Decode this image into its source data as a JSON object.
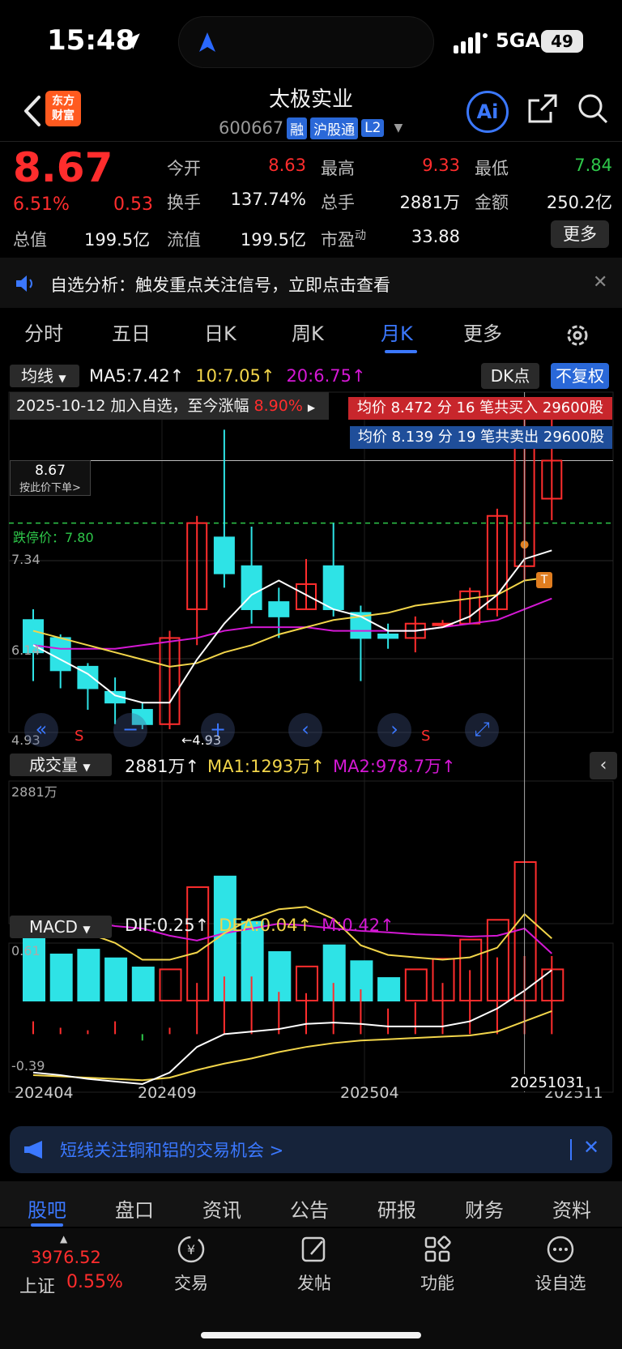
{
  "status_bar": {
    "time": "15:48",
    "network": "5GA",
    "battery": "49"
  },
  "header": {
    "brand_logo": "东方\n财富",
    "stock_name": "太极实业",
    "stock_code": "600667",
    "tags": [
      "融",
      "沪股通",
      "L2"
    ],
    "ai_label": "Ai"
  },
  "quote": {
    "price": "8.67",
    "pct_change": "6.51%",
    "change": "0.53",
    "open_label": "今开",
    "open": "8.63",
    "high_label": "最高",
    "high": "9.33",
    "low_label": "最低",
    "low": "7.84",
    "turnover_label": "换手",
    "turnover": "137.74%",
    "volume_label": "总手",
    "volume": "2881万",
    "amount_label": "金额",
    "amount": "250.2亿",
    "mcap_label": "总值",
    "mcap": "199.5亿",
    "float_label": "流值",
    "float_mcap": "199.5亿",
    "pe_label": "市盈",
    "pe_sup": "动",
    "pe": "33.88",
    "more_label": "更多"
  },
  "notice": {
    "text": "自选分析：触发重点关注信号，立即点击查看"
  },
  "chart_tabs": [
    "分时",
    "五日",
    "日K",
    "周K",
    "月K",
    "更多"
  ],
  "active_tab": "月K",
  "indicators": {
    "ma_select": "均线",
    "ma5": "MA5:7.42↑",
    "ma10": "10:7.05↑",
    "ma20": "20:6.75↑",
    "dk_label": "DK点",
    "adjust_label": "不复权"
  },
  "overlays": {
    "alert": "2025-10-12 加入自选，至今涨幅",
    "alert_pct": "8.90%",
    "buy": "均价 8.472 分 16 笔共买入 29600股",
    "sell": "均价 8.139 分 19 笔共卖出 29600股",
    "cur_price": "8.67",
    "cur_price_hint": "按此价下单>",
    "limit_down": "跌停价：7.80",
    "y_label_734": "7.34",
    "y_label_614": "6.14",
    "y_label_493": "4.93",
    "min_marker": "←4.93",
    "sell_marker": "S",
    "t_marker": "T",
    "cursor_date": "20251031"
  },
  "volume_panel": {
    "select": "成交量",
    "vol": "2881万↑",
    "ma1": "MA1:1293万↑",
    "ma2": "MA2:978.7万↑",
    "y_max": "2881万"
  },
  "macd_panel": {
    "select": "MACD",
    "dif": "DIF:0.25↑",
    "dea": "DEA:0.04↑",
    "m": "M:0.42↑",
    "y_max": "0.61",
    "y_min": "-0.39"
  },
  "x_axis": [
    "202404",
    "202409",
    "202504",
    "202511"
  ],
  "chart_data": {
    "type": "candlestick",
    "ylim": [
      4.93,
      9.33
    ],
    "candles": [
      {
        "o": 6.45,
        "c": 6.0,
        "h": 6.6,
        "l": 5.6
      },
      {
        "o": 6.2,
        "c": 5.75,
        "h": 6.25,
        "l": 5.5
      },
      {
        "o": 5.8,
        "c": 5.5,
        "h": 5.85,
        "l": 5.2
      },
      {
        "o": 5.45,
        "c": 5.3,
        "h": 5.65,
        "l": 5.0
      },
      {
        "o": 5.2,
        "c": 5.0,
        "h": 5.3,
        "l": 4.93
      },
      {
        "o": 5.0,
        "c": 6.2,
        "h": 6.3,
        "l": 4.93
      },
      {
        "o": 6.6,
        "c": 7.8,
        "h": 7.9,
        "l": 6.1
      },
      {
        "o": 7.6,
        "c": 7.1,
        "h": 9.1,
        "l": 6.9
      },
      {
        "o": 7.2,
        "c": 6.6,
        "h": 7.75,
        "l": 6.4
      },
      {
        "o": 6.7,
        "c": 6.5,
        "h": 6.9,
        "l": 6.2
      },
      {
        "o": 6.6,
        "c": 6.95,
        "h": 7.3,
        "l": 6.6
      },
      {
        "o": 7.2,
        "c": 6.6,
        "h": 7.8,
        "l": 6.5
      },
      {
        "o": 6.55,
        "c": 6.2,
        "h": 6.65,
        "l": 5.6
      },
      {
        "o": 6.25,
        "c": 6.2,
        "h": 6.4,
        "l": 6.05
      },
      {
        "o": 6.2,
        "c": 6.4,
        "h": 6.5,
        "l": 6.0
      },
      {
        "o": 6.4,
        "c": 6.4,
        "h": 6.45,
        "l": 6.4
      },
      {
        "o": 6.4,
        "c": 6.85,
        "h": 6.9,
        "l": 6.4
      },
      {
        "o": 6.6,
        "c": 7.9,
        "h": 8.0,
        "l": 6.5
      },
      {
        "o": 7.2,
        "c": 9.08,
        "h": 9.33,
        "l": 7.0
      },
      {
        "o": 8.14,
        "c": 8.67,
        "h": 9.33,
        "l": 7.84
      }
    ],
    "ma5": [
      6.1,
      5.9,
      5.7,
      5.4,
      5.3,
      5.3,
      5.9,
      6.4,
      6.8,
      7.0,
      6.8,
      6.6,
      6.5,
      6.3,
      6.3,
      6.35,
      6.5,
      6.8,
      7.3,
      7.42
    ],
    "ma10": [
      6.3,
      6.2,
      6.1,
      6.0,
      5.9,
      5.8,
      5.85,
      6.0,
      6.1,
      6.25,
      6.35,
      6.45,
      6.5,
      6.55,
      6.65,
      6.7,
      6.75,
      6.8,
      7.0,
      7.05
    ],
    "ma20": [
      6.1,
      6.05,
      6.05,
      6.05,
      6.1,
      6.15,
      6.2,
      6.3,
      6.35,
      6.35,
      6.35,
      6.3,
      6.3,
      6.3,
      6.3,
      6.35,
      6.4,
      6.45,
      6.6,
      6.75
    ],
    "volume": [
      1580,
      960,
      1060,
      880,
      690,
      650,
      2360,
      2581,
      1640,
      1010,
      710,
      1150,
      820,
      470,
      650,
      870,
      1270,
      1680,
      2881,
      650
    ],
    "volume_ma1": [
      1550,
      1500,
      1400,
      1200,
      850,
      850,
      1000,
      1400,
      1700,
      1900,
      1950,
      1700,
      1150,
      950,
      900,
      850,
      900,
      1100,
      1800,
      1293
    ],
    "volume_ma2": [
      1750,
      1700,
      1650,
      1550,
      1500,
      1350,
      1250,
      1400,
      1500,
      1600,
      1560,
      1500,
      1450,
      1420,
      1380,
      1360,
      1330,
      1350,
      1500,
      978.7
    ],
    "macd_hist": [
      0.1,
      0.05,
      0.03,
      0.1,
      -0.05,
      0.05,
      0.4,
      0.45,
      0.45,
      0.33,
      0.32,
      0.4,
      0.35,
      0.2,
      0.25,
      0.4,
      0.5,
      0.6,
      0.61,
      0.61
    ],
    "dif": [
      -0.3,
      -0.32,
      -0.35,
      -0.37,
      -0.39,
      -0.3,
      -0.1,
      0.0,
      0.02,
      0.04,
      0.08,
      0.09,
      0.08,
      0.06,
      0.06,
      0.06,
      0.1,
      0.2,
      0.34,
      0.5
    ],
    "dea": [
      -0.32,
      -0.33,
      -0.34,
      -0.35,
      -0.36,
      -0.34,
      -0.28,
      -0.23,
      -0.19,
      -0.14,
      -0.1,
      -0.07,
      -0.05,
      -0.04,
      -0.03,
      -0.02,
      -0.01,
      0.02,
      0.1,
      0.18
    ]
  },
  "promo": {
    "text": "短线关注铜和铝的交易机会 >"
  },
  "bottom_tabs": [
    "股吧",
    "盘口",
    "资讯",
    "公告",
    "研报",
    "财务",
    "资料"
  ],
  "index": {
    "value": "3976.52",
    "name": "上证",
    "pct": "0.55%"
  },
  "dock": [
    "交易",
    "发帖",
    "功能",
    "设自选"
  ],
  "colors": {
    "up": "#ff2d2d",
    "down": "#2ee3e6",
    "accent": "#3b78ff",
    "ma5": "#ffffff",
    "ma10": "#f2d54a",
    "ma20": "#d418d4"
  }
}
